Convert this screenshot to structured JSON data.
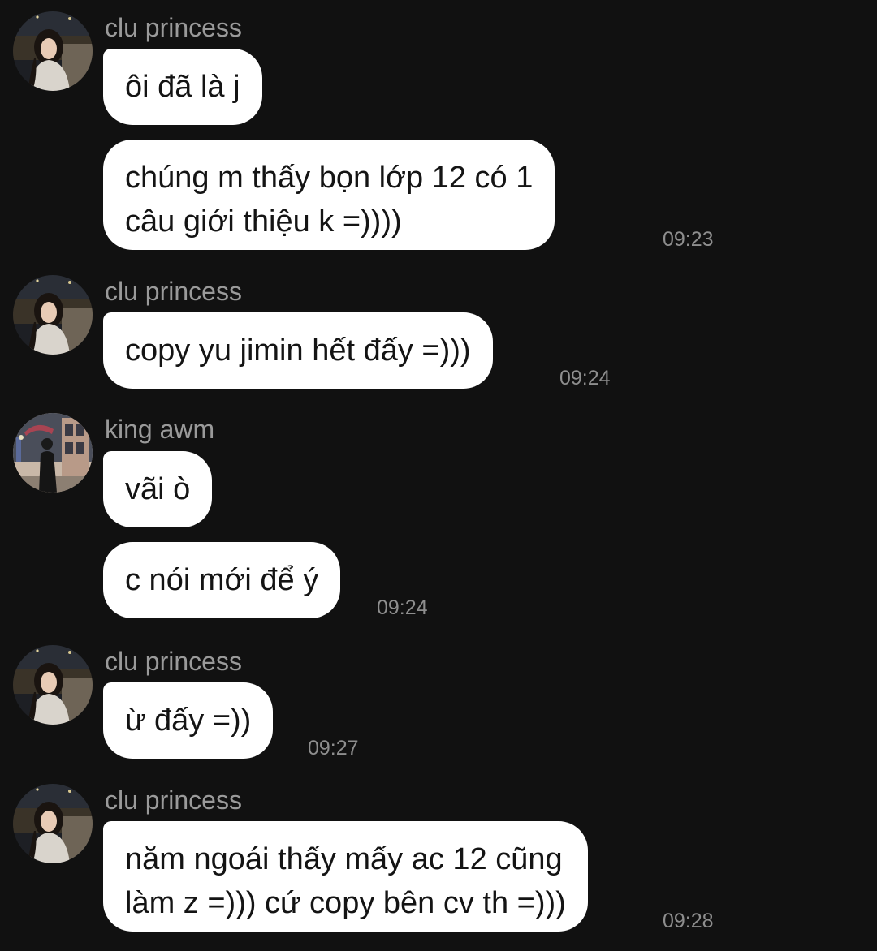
{
  "messages": [
    {
      "sender": "clu princess",
      "avatar": "clu-princess",
      "bubbles": [
        {
          "lines": [
            "ôi đã là j"
          ]
        },
        {
          "lines": [
            "chúng m thấy bọn lớp 12 có 1",
            "câu giới thiệu k =))))"
          ],
          "time": "09:23"
        }
      ]
    },
    {
      "sender": "clu princess",
      "avatar": "clu-princess",
      "bubbles": [
        {
          "lines": [
            "copy yu jimin hết đấy =)))"
          ],
          "time": "09:24"
        }
      ]
    },
    {
      "sender": "king awm",
      "avatar": "king-awm",
      "bubbles": [
        {
          "lines": [
            "vãi ò"
          ]
        },
        {
          "lines": [
            "c nói mới để ý"
          ],
          "time": "09:24"
        }
      ]
    },
    {
      "sender": "clu princess",
      "avatar": "clu-princess",
      "bubbles": [
        {
          "lines": [
            "ừ đấy =))"
          ],
          "time": "09:27"
        }
      ]
    },
    {
      "sender": "clu princess",
      "avatar": "clu-princess",
      "bubbles": [
        {
          "lines": [
            "năm ngoái thấy mấy ac 12 cũng",
            "làm z =))) cứ copy bên cv th =)))"
          ],
          "time": "09:28"
        }
      ]
    }
  ],
  "colors": {
    "background": "#111111",
    "bubble": "#ffffff",
    "bubble_text": "#141414",
    "sender_name": "#9a9a9a",
    "timestamp": "#8e8e8e"
  }
}
